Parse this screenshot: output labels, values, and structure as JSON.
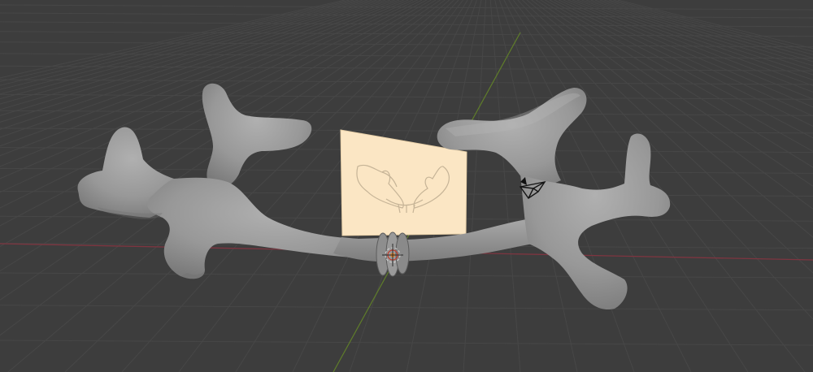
{
  "viewport": {
    "background_color": "#3d3d3d",
    "grid_color": "#4a4a4a",
    "x_axis_color": "#8a3a44",
    "y_axis_color": "#6b8a2e"
  },
  "scene": {
    "antler_mesh": {
      "color": "#9a9a9a",
      "shading_color": "#7e7e7e",
      "highlight_color": "#b2b2b2"
    },
    "reference_image_plane": {
      "fill_color": "#fbe6c4",
      "sketch_color": "#c9b89c"
    },
    "ring_mesh": {
      "color": "#8c8c8c"
    },
    "origin_marker": {
      "color": "#e8862a"
    },
    "camera_object": {
      "color": "#111111"
    }
  }
}
